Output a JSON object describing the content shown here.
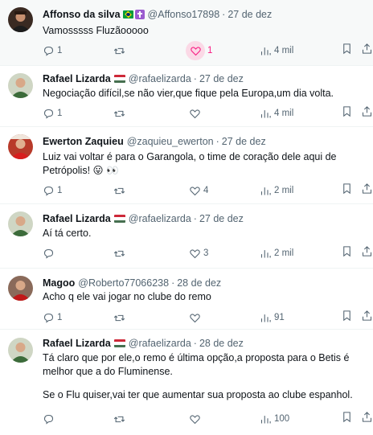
{
  "tweets": [
    {
      "name": "Affonso da silva",
      "badges": [
        "brazil-flag",
        "latin-cross"
      ],
      "handle": "@Affonso17898",
      "time": "27 de dez",
      "text": [
        "Vamosssss Fluzãooooo"
      ],
      "replies": "1",
      "retweets": "",
      "likes": "1",
      "liked_highlight": true,
      "views": "4 mil"
    },
    {
      "name": "Rafael Lizarda",
      "badges": [
        "hungary-flag"
      ],
      "handle": "@rafaelizarda",
      "time": "27 de dez",
      "text": [
        "Negociação difícil,se não vier,que fique pela Europa,um dia volta."
      ],
      "replies": "1",
      "retweets": "",
      "likes": "",
      "views": "4 mil"
    },
    {
      "name": "Ewerton Zaquieu",
      "badges": [],
      "handle": "@zaquieu_ewerton",
      "time": "27 de dez",
      "text": [
        "Luiz vai voltar é para o Garangola, o time de coração dele aqui de Petrópolis! 😛 👀"
      ],
      "replies": "1",
      "retweets": "",
      "likes": "4",
      "views": "2 mil"
    },
    {
      "name": "Rafael Lizarda",
      "badges": [
        "hungary-flag"
      ],
      "handle": "@rafaelizarda",
      "time": "27 de dez",
      "text": [
        "Aí tá certo."
      ],
      "replies": "",
      "retweets": "",
      "likes": "3",
      "views": "2 mil"
    },
    {
      "name": "Magoo",
      "badges": [],
      "handle": "@Roberto77066238",
      "time": "28 de dez",
      "text": [
        "Acho q ele vai jogar no clube do remo"
      ],
      "replies": "1",
      "retweets": "",
      "likes": "",
      "views": "91"
    },
    {
      "name": "Rafael Lizarda",
      "badges": [
        "hungary-flag"
      ],
      "handle": "@rafaelizarda",
      "time": "28 de dez",
      "text": [
        "Tá claro que por ele,o remo é última opção,a proposta para o Betis é melhor que a do Fluminense.",
        "Se o Flu quiser,vai ter que aumentar sua proposta ao clube espanhol."
      ],
      "replies": "",
      "retweets": "",
      "likes": "",
      "views": "100"
    }
  ],
  "colors": {
    "text": "#0f1419",
    "secondary": "#536471",
    "like_pink": "#f91880",
    "divider": "#eff3f4"
  },
  "icons": {
    "reply": "reply-icon",
    "retweet": "retweet-icon",
    "like": "heart-icon",
    "views": "views-icon",
    "bookmark": "bookmark-icon",
    "share": "share-icon"
  }
}
